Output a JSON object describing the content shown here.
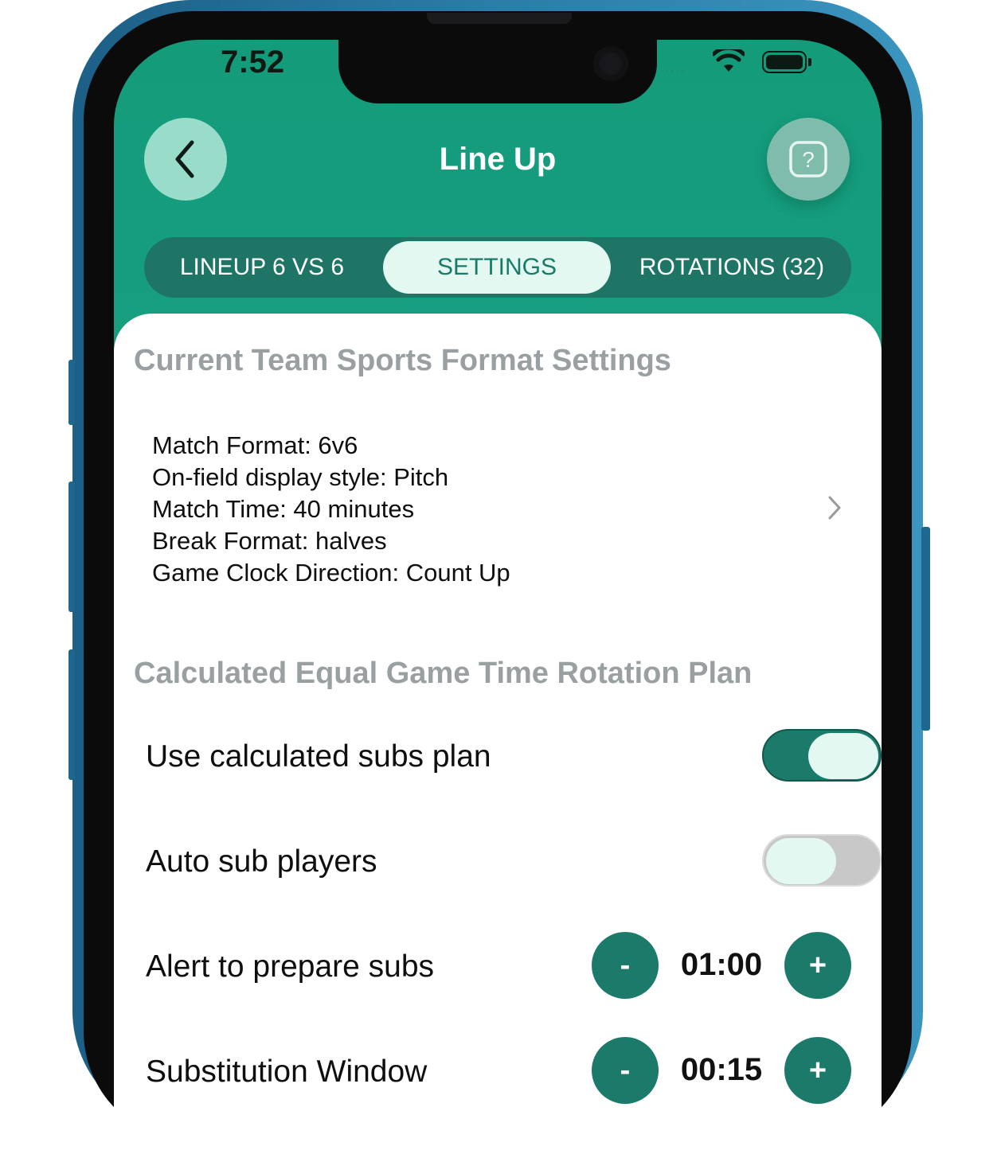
{
  "status_bar": {
    "time": "7:52",
    "signal_dots": "····"
  },
  "header": {
    "title": "Line Up",
    "back_icon": "chevron-left-icon",
    "help_icon": "question-icon"
  },
  "tabs": [
    {
      "label": "LINEUP 6 VS 6",
      "active": false
    },
    {
      "label": "SETTINGS",
      "active": true
    },
    {
      "label": "ROTATIONS (32)",
      "active": false
    }
  ],
  "format_section": {
    "heading": "Current Team Sports Format Settings",
    "lines": [
      "Match Format: 6v6",
      "On-field display style: Pitch",
      "Match Time: 40 minutes",
      "Break Format: halves",
      "Game Clock Direction: Count Up"
    ]
  },
  "rotation_section": {
    "heading": "Calculated Equal Game Time Rotation Plan",
    "use_calculated": {
      "label": "Use calculated subs plan",
      "on": true
    },
    "auto_sub": {
      "label": "Auto sub players",
      "on": false
    },
    "alert": {
      "label": "Alert to prepare subs",
      "value": "01:00",
      "minus": "-",
      "plus": "+"
    },
    "window": {
      "label": "Substitution Window",
      "value": "00:15",
      "minus": "-",
      "plus": "+"
    }
  },
  "colors": {
    "accent": "#1c7a6a",
    "header_green": "#139b7a",
    "tab_active_bg": "#e3f8f1"
  }
}
